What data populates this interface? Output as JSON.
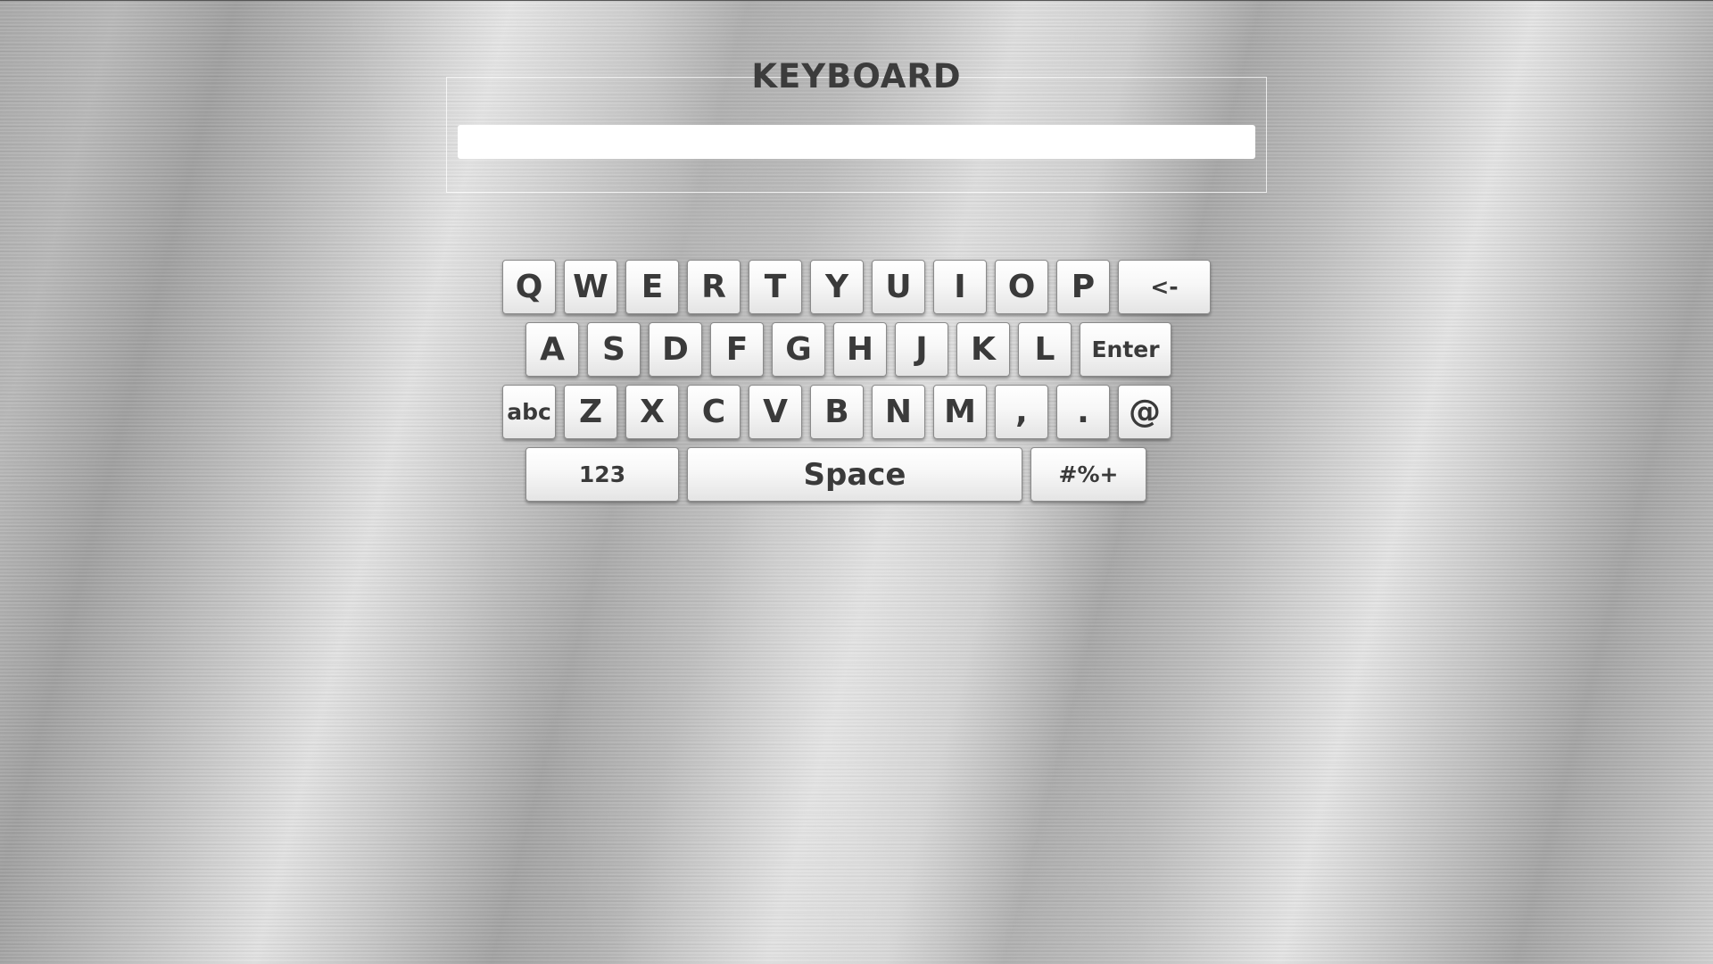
{
  "title": "KEYBOARD",
  "input": {
    "value": "",
    "placeholder": ""
  },
  "keys": {
    "row1": [
      "Q",
      "W",
      "E",
      "R",
      "T",
      "Y",
      "U",
      "I",
      "O",
      "P"
    ],
    "backspace": "<-",
    "row2": [
      "A",
      "S",
      "D",
      "F",
      "G",
      "H",
      "J",
      "K",
      "L"
    ],
    "enter": "Enter",
    "abc": "abc",
    "row3": [
      "Z",
      "X",
      "C",
      "V",
      "B",
      "N",
      "M",
      ",",
      "."
    ],
    "at": "@",
    "numbers": "123",
    "space": "Space",
    "symbols": "#%+"
  },
  "colors": {
    "text": "#3a3a3a",
    "key_face": "#f4f4f4",
    "field": "#ffffff"
  }
}
